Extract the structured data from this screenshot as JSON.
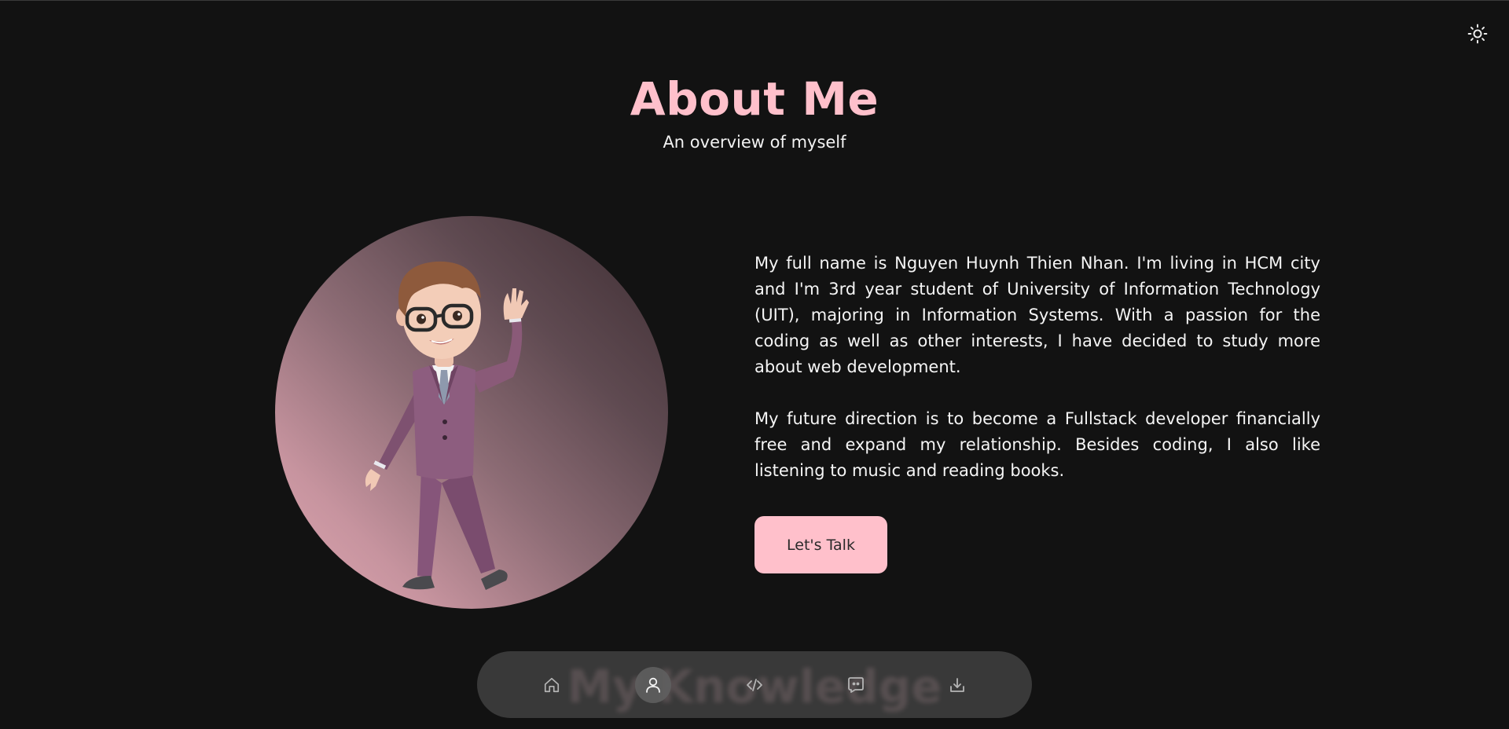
{
  "header": {
    "title": "About Me",
    "subtitle": "An overview of myself"
  },
  "theme_toggle": {
    "icon": "sun-icon"
  },
  "about": {
    "paragraphs": [
      "My full name is Nguyen Huynh Thien Nhan. I'm living in HCM city and I'm 3rd year student of University of Information Technology (UIT), majoring in Information Systems. With a passion for the coding as well as other interests, I have decided to study more about web development.",
      "My future direction is to become a Fullstack developer financially free and expand my relationship. Besides coding, I also like listening to music and reading books."
    ],
    "cta_label": "Let's Talk"
  },
  "next_section": {
    "title": "My Knowledge"
  },
  "dock": {
    "items": [
      {
        "icon": "home-icon",
        "active": false
      },
      {
        "icon": "user-icon",
        "active": true
      },
      {
        "icon": "code-icon",
        "active": false
      },
      {
        "icon": "chat-icon",
        "active": false
      },
      {
        "icon": "download-icon",
        "active": false
      }
    ]
  },
  "colors": {
    "background": "#121212",
    "accent": "#ffc0cb",
    "text": "#f5f5f5",
    "dock": "#484848"
  }
}
